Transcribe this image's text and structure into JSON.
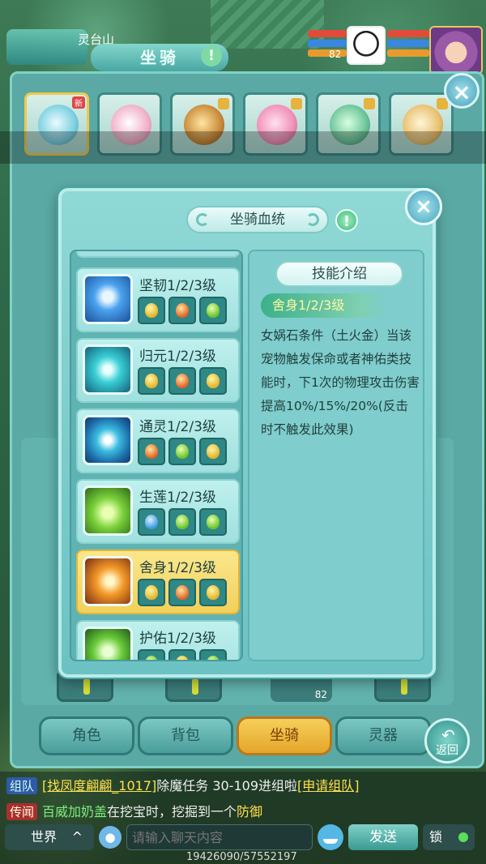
{
  "hud": {
    "place_name": "灵台山",
    "panel_title": "坐骑",
    "pet_level": "82"
  },
  "mount_window": {
    "close_label": "×"
  },
  "tabs": [
    {
      "label": "角色",
      "active": false
    },
    {
      "label": "背包",
      "active": false
    },
    {
      "label": "坐骑",
      "active": true
    },
    {
      "label": "灵器",
      "active": false
    }
  ],
  "back_label": "返回",
  "background_pet_level": "82",
  "bloodline_dialog": {
    "title": "坐骑血统",
    "close_label": "×",
    "info_icon": "!",
    "skills": [
      {
        "name": "坚韧1/2/3级",
        "icon": "guard-figure-icon",
        "gems": [
          "y",
          "r",
          "g"
        ]
      },
      {
        "name": "归元1/2/3级",
        "icon": "wave-icon",
        "gems": [
          "y",
          "r",
          "y"
        ]
      },
      {
        "name": "通灵1/2/3级",
        "icon": "vortex-icon",
        "gems": [
          "r",
          "g",
          "y"
        ]
      },
      {
        "name": "生莲1/2/3级",
        "icon": "lotus-icon",
        "gems": [
          "b",
          "g",
          "g"
        ]
      },
      {
        "name": "舍身1/2/3级",
        "icon": "burst-icon",
        "gems": [
          "y",
          "r",
          "y"
        ],
        "selected": true
      },
      {
        "name": "护佑1/2/3级",
        "icon": "shield-icon",
        "gems": [
          "g",
          "y",
          "g"
        ]
      }
    ],
    "intro": {
      "header": "技能介绍",
      "skill_name": "舍身1/2/3级",
      "description": "女娲石条件（土火金）当该宠物触发保命或者神佑类技能时，下1次的物理攻击伤害提高10%/15%/20%(反击时不触发此效果)"
    }
  },
  "chat": {
    "line1_tag": "组队",
    "line1_link": "[找凤度翩翩_1017]",
    "line1_text": "除魔任务 30-109进组啦",
    "line1_apply": "[申请组队]",
    "line2_tag": "传闻",
    "line2_name": "百威加奶盖",
    "line2_text": "在挖宝时，挖掘到一个",
    "line2_item": "防御",
    "channel": "世界",
    "input_placeholder": "请输入聊天内容",
    "send_label": "发送",
    "lock_label": "锁",
    "exp": "19426090/57552197"
  },
  "colors": {
    "accent": "#6cc2c3",
    "selected": "#f2d05a"
  }
}
